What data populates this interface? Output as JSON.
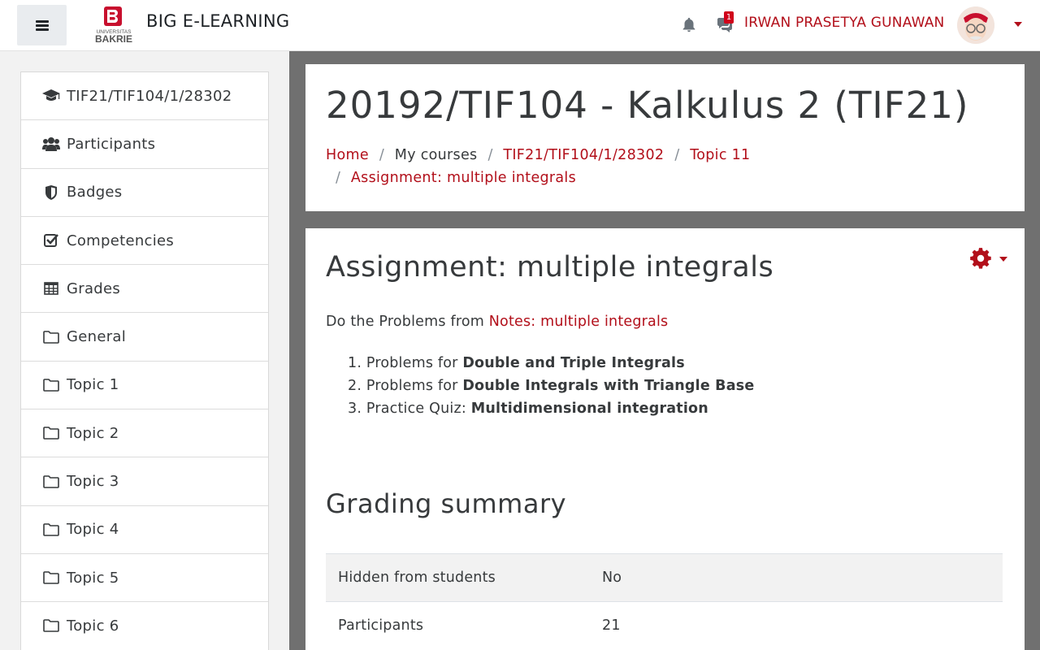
{
  "navbar": {
    "site_name": "BIG E-LEARNING",
    "logo_top": "UNIVERSITAS",
    "logo_bottom": "BAKRIE",
    "message_count": "1",
    "user_name": "IRWAN PRASETYA GUNAWAN"
  },
  "sidebar": {
    "items": [
      {
        "label": "TIF21/TIF104/1/28302",
        "icon": "graduation-cap-icon"
      },
      {
        "label": "Participants",
        "icon": "users-icon"
      },
      {
        "label": "Badges",
        "icon": "shield-icon"
      },
      {
        "label": "Competencies",
        "icon": "check-square-icon"
      },
      {
        "label": "Grades",
        "icon": "table-icon"
      },
      {
        "label": "General",
        "icon": "folder-icon"
      },
      {
        "label": "Topic 1",
        "icon": "folder-icon"
      },
      {
        "label": "Topic 2",
        "icon": "folder-icon"
      },
      {
        "label": "Topic 3",
        "icon": "folder-icon"
      },
      {
        "label": "Topic 4",
        "icon": "folder-icon"
      },
      {
        "label": "Topic 5",
        "icon": "folder-icon"
      },
      {
        "label": "Topic 6",
        "icon": "folder-icon"
      }
    ]
  },
  "header": {
    "title": "20192/TIF104 - Kalkulus 2 (TIF21)",
    "breadcrumb": {
      "home": "Home",
      "my_courses": "My courses",
      "course": "TIF21/TIF104/1/28302",
      "topic": "Topic 11",
      "assignment": "Assignment: multiple integrals"
    }
  },
  "assignment": {
    "title": "Assignment: multiple integrals",
    "intro_prefix": "Do the Problems from ",
    "intro_link": "Notes: multiple integrals",
    "tasks": [
      {
        "num": "1.",
        "prefix": "Problems for ",
        "bold": "Double and Triple Integrals"
      },
      {
        "num": "2.",
        "prefix": "Problems for ",
        "bold": "Double Integrals with Triangle Base"
      },
      {
        "num": "3.",
        "prefix": "Practice Quiz: ",
        "bold": "Multidimensional integration"
      }
    ]
  },
  "grading": {
    "title": "Grading summary",
    "rows": [
      {
        "label": "Hidden from students",
        "value": "No"
      },
      {
        "label": "Participants",
        "value": "21"
      }
    ]
  },
  "colors": {
    "accent": "#b20f1a",
    "main_bg": "#707070",
    "page_bg": "#f2f2f2"
  }
}
